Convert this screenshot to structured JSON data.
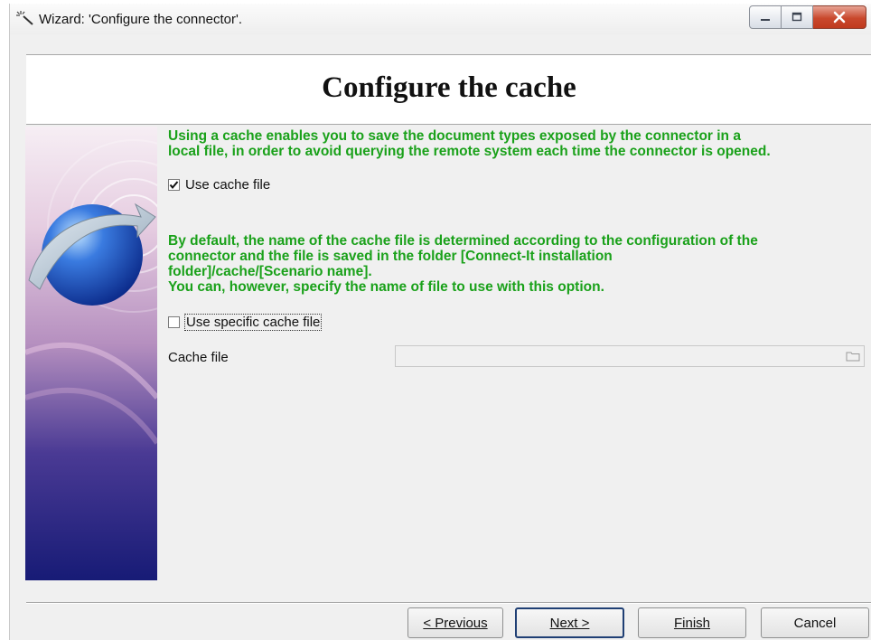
{
  "window": {
    "title": "Wizard: 'Configure the connector'."
  },
  "header": {
    "title": "Configure the cache"
  },
  "content": {
    "info_1": [
      "Using a cache enables you to save the document types exposed by the connector in a",
      "local file, in order to avoid querying the remote system each time the connector is opened."
    ],
    "use_cache_file": {
      "label": "Use cache file",
      "checked": true
    },
    "info_2": [
      "By default, the name of the cache file is determined according to the configuration of the",
      "connector and the file is saved in the folder [Connect-It installation",
      "folder]/cache/[Scenario name]."
    ],
    "info_3": "You can, however, specify the name of file to use with this option.",
    "use_specific_cache_file": {
      "label": "Use specific cache file",
      "checked": false
    },
    "cache_file": {
      "label": "Cache file",
      "value": ""
    }
  },
  "footer": {
    "previous_label": "< Previous",
    "next_label": "Next >",
    "finish_label": "Finish",
    "cancel_label": "Cancel"
  },
  "colors": {
    "info_text": "#1aa11a",
    "default_button_border": "#1f3f74",
    "close_button": "#c9482d"
  },
  "icons": {
    "app": "wand-icon",
    "side_panel": "globe-arrow-graphic",
    "browse": "folder-icon"
  }
}
